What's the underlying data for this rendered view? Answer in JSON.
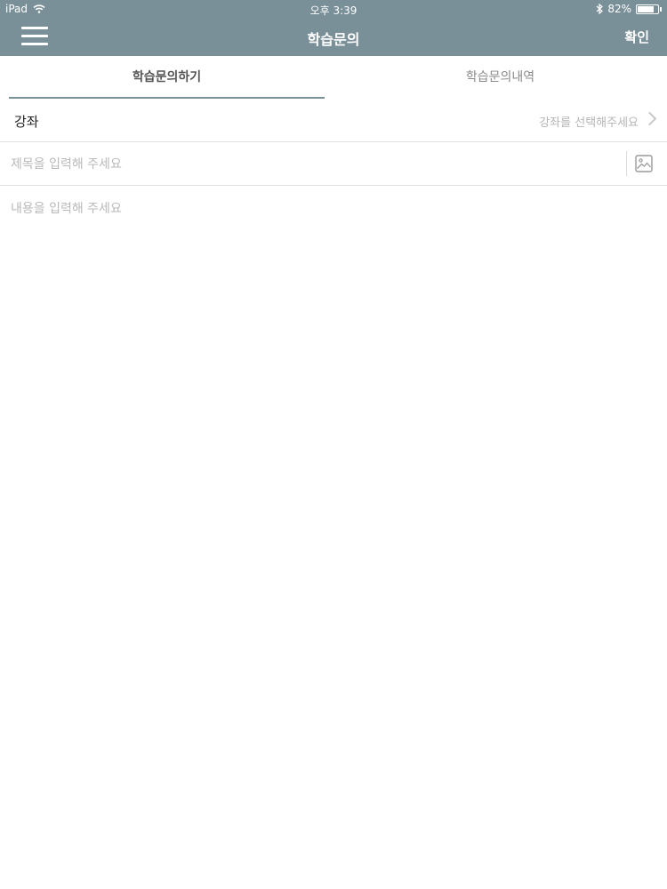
{
  "status_bar": {
    "device": "iPad",
    "time": "오후 3:39",
    "battery_percent": "82%",
    "battery_level": 0.82,
    "icons": [
      "wifi-icon",
      "bluetooth-icon",
      "battery-icon"
    ]
  },
  "nav": {
    "title": "학습문의",
    "confirm_label": "확인",
    "menu_icon": "hamburger-menu-icon"
  },
  "tabs": [
    {
      "label": "학습문의하기",
      "active": true
    },
    {
      "label": "학습문의내역",
      "active": false
    }
  ],
  "form": {
    "course_label": "강좌",
    "course_placeholder": "강좌를 선택해주세요",
    "title_placeholder": "제목을 입력해 주세요",
    "content_placeholder": "내용을 입력해 주세요",
    "title_value": "",
    "content_value": ""
  },
  "colors": {
    "header_bg": "#7a9098",
    "header_text": "#ffffff",
    "placeholder": "#b9b9b9",
    "divider": "#e0e0e0"
  }
}
